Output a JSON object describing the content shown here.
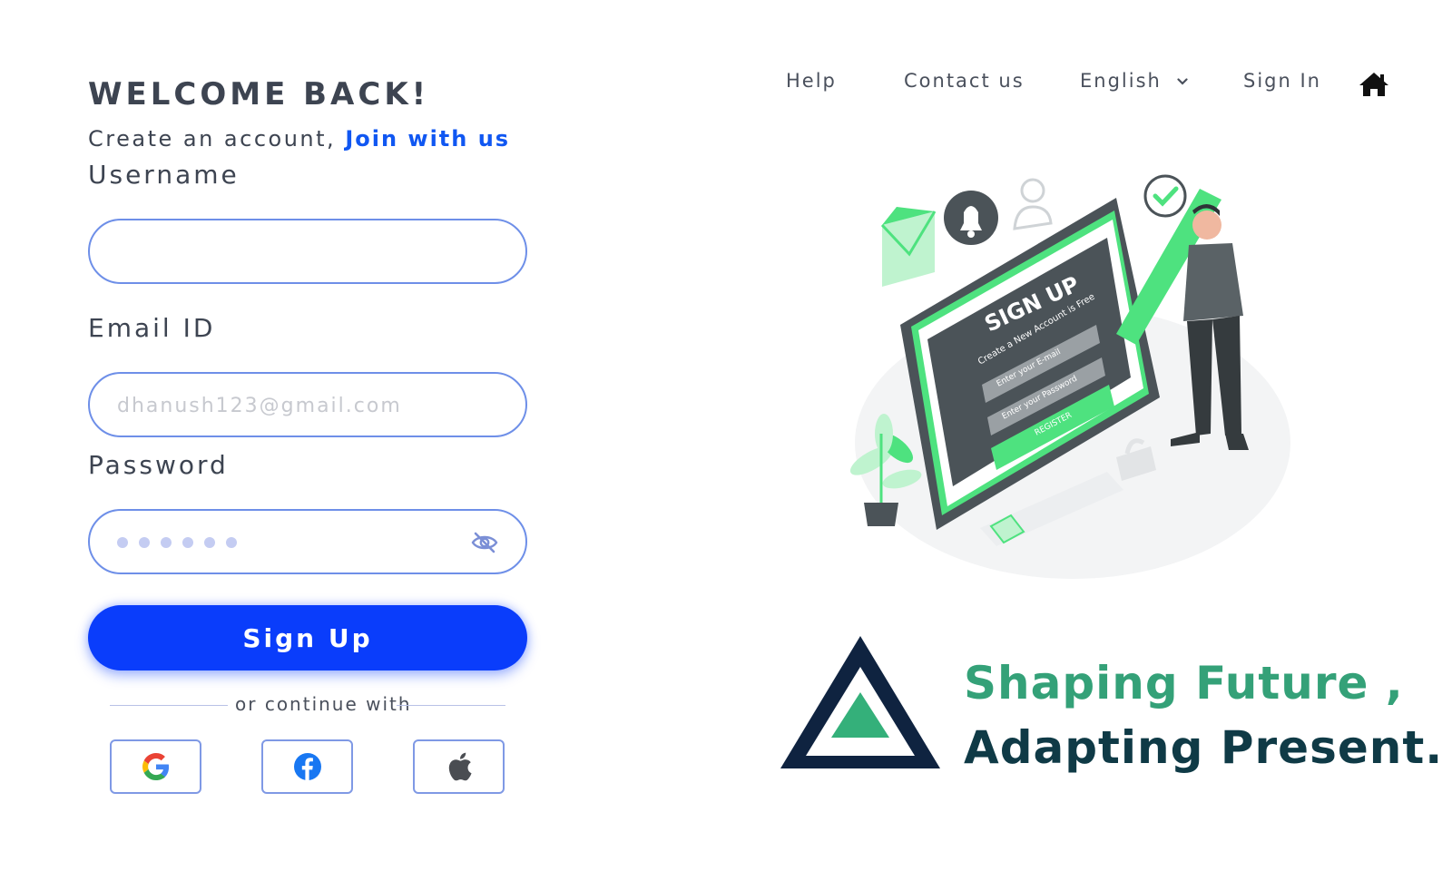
{
  "header": {
    "title": "WELCOME BACK!",
    "subtitle_prefix": "Create an account,",
    "join_link": "Join with us"
  },
  "form": {
    "username": {
      "label": "Username",
      "value": "",
      "placeholder": ""
    },
    "email": {
      "label": "Email ID",
      "value": "",
      "placeholder": "dhanush123@gmail.com"
    },
    "password": {
      "label": "Password",
      "masked_length": 6
    },
    "submit_label": "Sign Up",
    "divider_text": "or continue with",
    "social": [
      {
        "icon": "google-icon"
      },
      {
        "icon": "facebook-icon"
      },
      {
        "icon": "apple-icon"
      }
    ]
  },
  "nav": {
    "help": "Help",
    "contact": "Contact us",
    "language": "English",
    "sign_in": "Sign In",
    "home_icon": "home-icon"
  },
  "illustration": {
    "heading": "SIGN UP",
    "subheading": "Create a New Account is Free",
    "email_field": "Enter your E-mail",
    "password_field": "Enter your Password",
    "button": "REGISTER"
  },
  "brand": {
    "line1": "Shaping Future ,",
    "line2": "Adapting Present."
  },
  "colors": {
    "primary": "#0a3dfb",
    "link": "#1057f2",
    "field_border": "#6e8fe8",
    "brand_green": "#34a178",
    "brand_dark": "#0f3a46",
    "illus_green": "#4ee27f"
  }
}
